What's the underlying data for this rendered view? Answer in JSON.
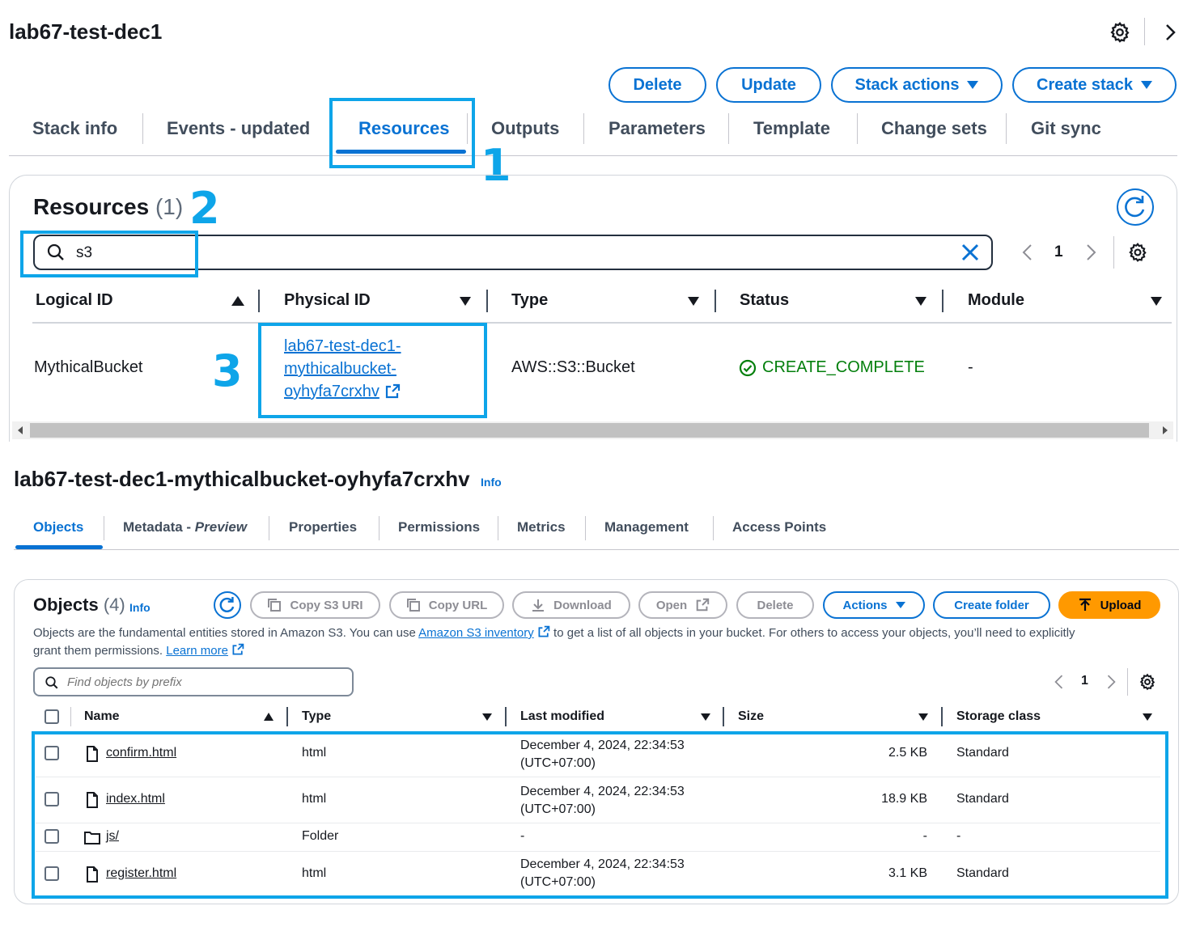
{
  "stack": {
    "title": "lab67-test-dec1",
    "buttons": {
      "delete": "Delete",
      "update": "Update",
      "stack_actions": "Stack actions",
      "create_stack": "Create stack"
    },
    "tabs": [
      "Stack info",
      "Events - updated",
      "Resources",
      "Outputs",
      "Parameters",
      "Template",
      "Change sets",
      "Git sync"
    ],
    "active_tab": "Resources"
  },
  "annotations": {
    "one": "1",
    "two": "2",
    "three": "3"
  },
  "resources": {
    "title": "Resources",
    "count": "(1)",
    "search_value": "s3",
    "page": "1",
    "columns": [
      "Logical ID",
      "Physical ID",
      "Type",
      "Status",
      "Module"
    ],
    "row": {
      "logical_id": "MythicalBucket",
      "physical_id_lines": [
        "lab67-test-dec1-",
        "mythicalbucket-",
        "oyhyfa7crxhv"
      ],
      "type": "AWS::S3::Bucket",
      "status": "CREATE_COMPLETE",
      "module": "-"
    }
  },
  "bucket": {
    "title": "lab67-test-dec1-mythicalbucket-oyhyfa7crxhv",
    "info": "Info",
    "tabs": {
      "objects": "Objects",
      "metadata": "Metadata - ",
      "metadata_em": "Preview",
      "properties": "Properties",
      "permissions": "Permissions",
      "metrics": "Metrics",
      "management": "Management",
      "access_points": "Access Points"
    }
  },
  "objects": {
    "title": "Objects",
    "count": "(4)",
    "info": "Info",
    "buttons": {
      "copy_uri": "Copy S3 URI",
      "copy_url": "Copy URL",
      "download": "Download",
      "open": "Open",
      "delete": "Delete",
      "actions": "Actions",
      "create_folder": "Create folder",
      "upload": "Upload"
    },
    "desc_part1": "Objects are the fundamental entities stored in Amazon S3. You can use ",
    "desc_link1": "Amazon S3 inventory",
    "desc_part2": " to get a list of all objects in your bucket. For others to access your objects, you’ll need to explicitly",
    "desc_part3": "grant them permissions. ",
    "desc_link2": "Learn more",
    "search_placeholder": "Find objects by prefix",
    "page": "1",
    "columns": {
      "name": "Name",
      "type": "Type",
      "modified": "Last modified",
      "size": "Size",
      "storage": "Storage class"
    },
    "rows": [
      {
        "name": "confirm.html",
        "icon": "file-icon",
        "type": "html",
        "modified1": "December 4, 2024, 22:34:53",
        "modified2": "(UTC+07:00)",
        "size": "2.5 KB",
        "storage": "Standard"
      },
      {
        "name": "index.html",
        "icon": "file-icon",
        "type": "html",
        "modified1": "December 4, 2024, 22:34:53",
        "modified2": "(UTC+07:00)",
        "size": "18.9 KB",
        "storage": "Standard"
      },
      {
        "name": "js/",
        "icon": "folder-icon",
        "type": "Folder",
        "modified1": "-",
        "modified2": "",
        "size": "-",
        "storage": "-"
      },
      {
        "name": "register.html",
        "icon": "file-icon",
        "type": "html",
        "modified1": "December 4, 2024, 22:34:53",
        "modified2": "(UTC+07:00)",
        "size": "3.1 KB",
        "storage": "Standard"
      }
    ]
  },
  "colors": {
    "accent": "#0972d3",
    "success": "#037f0c",
    "annotation": "#0ea5e9",
    "upload": "#ff9900"
  }
}
